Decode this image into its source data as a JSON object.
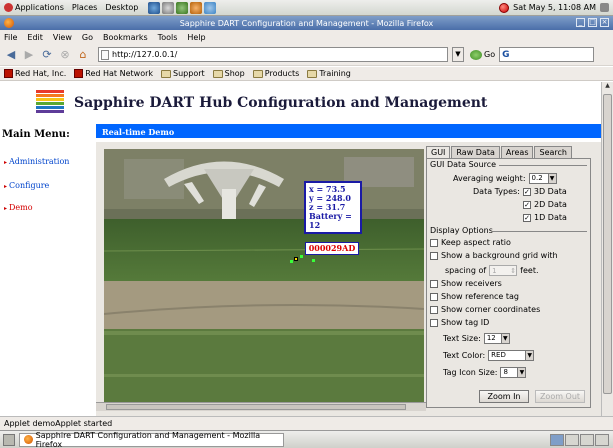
{
  "panel": {
    "menus": [
      "Applications",
      "Places",
      "Desktop"
    ],
    "clock": "Sat May  5, 11:08 AM"
  },
  "window": {
    "title": "Sapphire DART Configuration and Management - Mozilla Firefox"
  },
  "menubar": [
    "File",
    "Edit",
    "View",
    "Go",
    "Bookmarks",
    "Tools",
    "Help"
  ],
  "nav": {
    "url": "http://127.0.0.1/",
    "go_label": "Go",
    "search_text": "G"
  },
  "bookmarks": [
    {
      "label": "Red Hat, Inc.",
      "icon": "redhat-icon"
    },
    {
      "label": "Red Hat Network",
      "icon": "redhat-icon"
    },
    {
      "label": "Support",
      "icon": "folder-icon"
    },
    {
      "label": "Shop",
      "icon": "folder-icon"
    },
    {
      "label": "Products",
      "icon": "folder-icon"
    },
    {
      "label": "Training",
      "icon": "folder-icon"
    }
  ],
  "site": {
    "title": "Sapphire DART Hub Configuration and Management",
    "logo_colors": [
      "#e83a2b",
      "#f57a1e",
      "#f7c417",
      "#5aa833",
      "#1f78c4",
      "#5e3c99"
    ]
  },
  "sidebar": {
    "title": "Main Menu:",
    "items": [
      {
        "label": "Administration",
        "active": false
      },
      {
        "label": "Configure",
        "active": false
      },
      {
        "label": "Demo",
        "active": true
      }
    ]
  },
  "section_title": "Real-time Demo",
  "tag": {
    "x": "x = 73.5",
    "y": "y = 248.0",
    "z": "z = 31.7",
    "battery": "Battery = 12",
    "id": "000029AD"
  },
  "controls": {
    "tabs": [
      "GUI",
      "Raw Data",
      "Areas",
      "Search"
    ],
    "active_tab": "GUI",
    "data_source": {
      "heading": "GUI Data Source",
      "averaging_label": "Averaging weight:",
      "averaging_value": "0.2",
      "data_types_label": "Data Types:",
      "types": [
        {
          "label": "3D Data",
          "checked": true
        },
        {
          "label": "2D Data",
          "checked": true
        },
        {
          "label": "1D Data",
          "checked": true
        }
      ]
    },
    "display": {
      "heading": "Display Options",
      "keep_aspect": "Keep aspect ratio",
      "bg_grid": "Show a background grid with",
      "spacing_label": "spacing of",
      "spacing_value": "1",
      "spacing_unit": "feet.",
      "show_receivers": "Show receivers",
      "show_reference": "Show reference tag",
      "show_corners": "Show corner coordinates",
      "show_tag_id": "Show tag ID",
      "text_size_label": "Text Size:",
      "text_size_value": "12",
      "text_color_label": "Text Color:",
      "text_color_value": "RED",
      "icon_size_label": "Tag Icon Size:",
      "icon_size_value": "8"
    },
    "zoom_in": "Zoom In",
    "zoom_out": "Zoom Out"
  },
  "status": "Applet demoApplet started",
  "taskbar": {
    "task": "Sapphire DART Configuration and Management - Mozilla Firefox"
  },
  "colors": {
    "section_bar": "#0066ff",
    "link": "#0044cc",
    "active_link": "#d40000",
    "tag_box": "#1a1aa5"
  }
}
